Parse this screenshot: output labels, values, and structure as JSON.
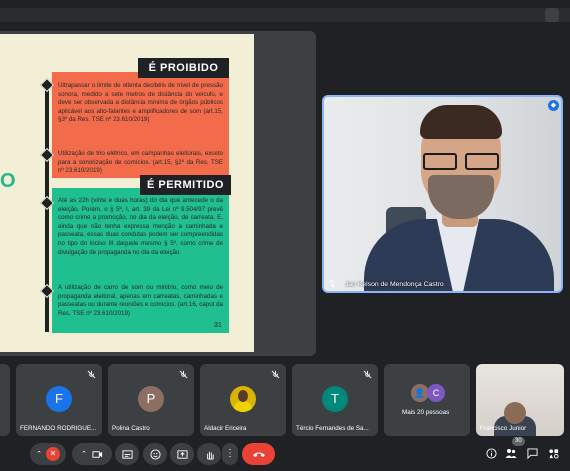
{
  "slide": {
    "big_letter": "O",
    "prohibited_header": "É PROIBIDO",
    "prohibited_items": [
      "Ultrapassar o limite de oitenta decibéis de nível de pressão sonora, medido a sete metros de distância do veículo, e deve ser observada a distância mínima de órgãos públicos aplicável aos alto-falantes e amplificadores de som (art.15, §3º da Res. TSE nº 23.610/2019)",
      "Utilização de trio elétrico, em campanhas eleitorais, exceto para a sonorização de comícios. (art.15, §2º da Res. TSE nº 23.610/2019)"
    ],
    "permitted_header": "É PERMITIDO",
    "permitted_items": [
      "Até as 22h (vinte e duas horas) do dia que antecede o da eleição. Porém, o § 5º, I, art. 39 da Lei nº 9.504/97 prevê como crime a promoção, no dia da eleição, de carreata. E, ainda que não tenha expressa menção a caminhada e passeata, essas duas condutas podem ser compreendidas no tipo do inciso III daquele mesmo § 5º, como crime de divulgação de propaganda no dia da eleição.",
      "A utilização de carro de som ou minitrio, como meio de propaganda eleitoral, apenas em carreatas, caminhadas e passeatas ou durante reuniões e comícios. (art.16, caput da Res. TSE nº 23.610/2019)"
    ],
    "page_number": "31"
  },
  "speaker": {
    "name": "Jan Kelson de Mendonça Castro",
    "badge_icon": "audio-wave-icon"
  },
  "participants": [
    {
      "name": "FERNANDO RODRIGUE...",
      "initial": "F",
      "color": "#1a73e8"
    },
    {
      "name": "Polina Castro",
      "initial": "P",
      "color": "#8d6e63"
    },
    {
      "name": "Aldacir Ericeira",
      "initial": "",
      "color": "#d8b400"
    },
    {
      "name": "Tércio Fernandes de Sa...",
      "initial": "T",
      "color": "#00897b"
    },
    {
      "name": "Mais 20 pessoas",
      "initial": "C",
      "color": "#7e57c2"
    },
    {
      "name": "Francisco Junior",
      "initial": "",
      "color": "#5f6368"
    }
  ],
  "controls": {
    "participant_count": "30",
    "icons": [
      "chevron-up-icon",
      "mic-off-icon",
      "chevron-up-icon",
      "camera-icon",
      "captions-icon",
      "emoji-icon",
      "present-icon",
      "raise-hand-icon",
      "more-icon",
      "end-call-icon"
    ],
    "right_icons": [
      "info-icon",
      "people-icon",
      "chat-icon",
      "activities-icon"
    ]
  },
  "colors": {
    "bg": "#202124",
    "tile": "#3c4043",
    "prohibited": "#f26b4a",
    "permitted": "#1fbf8f",
    "end_call": "#ea4335",
    "active_speaker": "#8ab4f8"
  }
}
